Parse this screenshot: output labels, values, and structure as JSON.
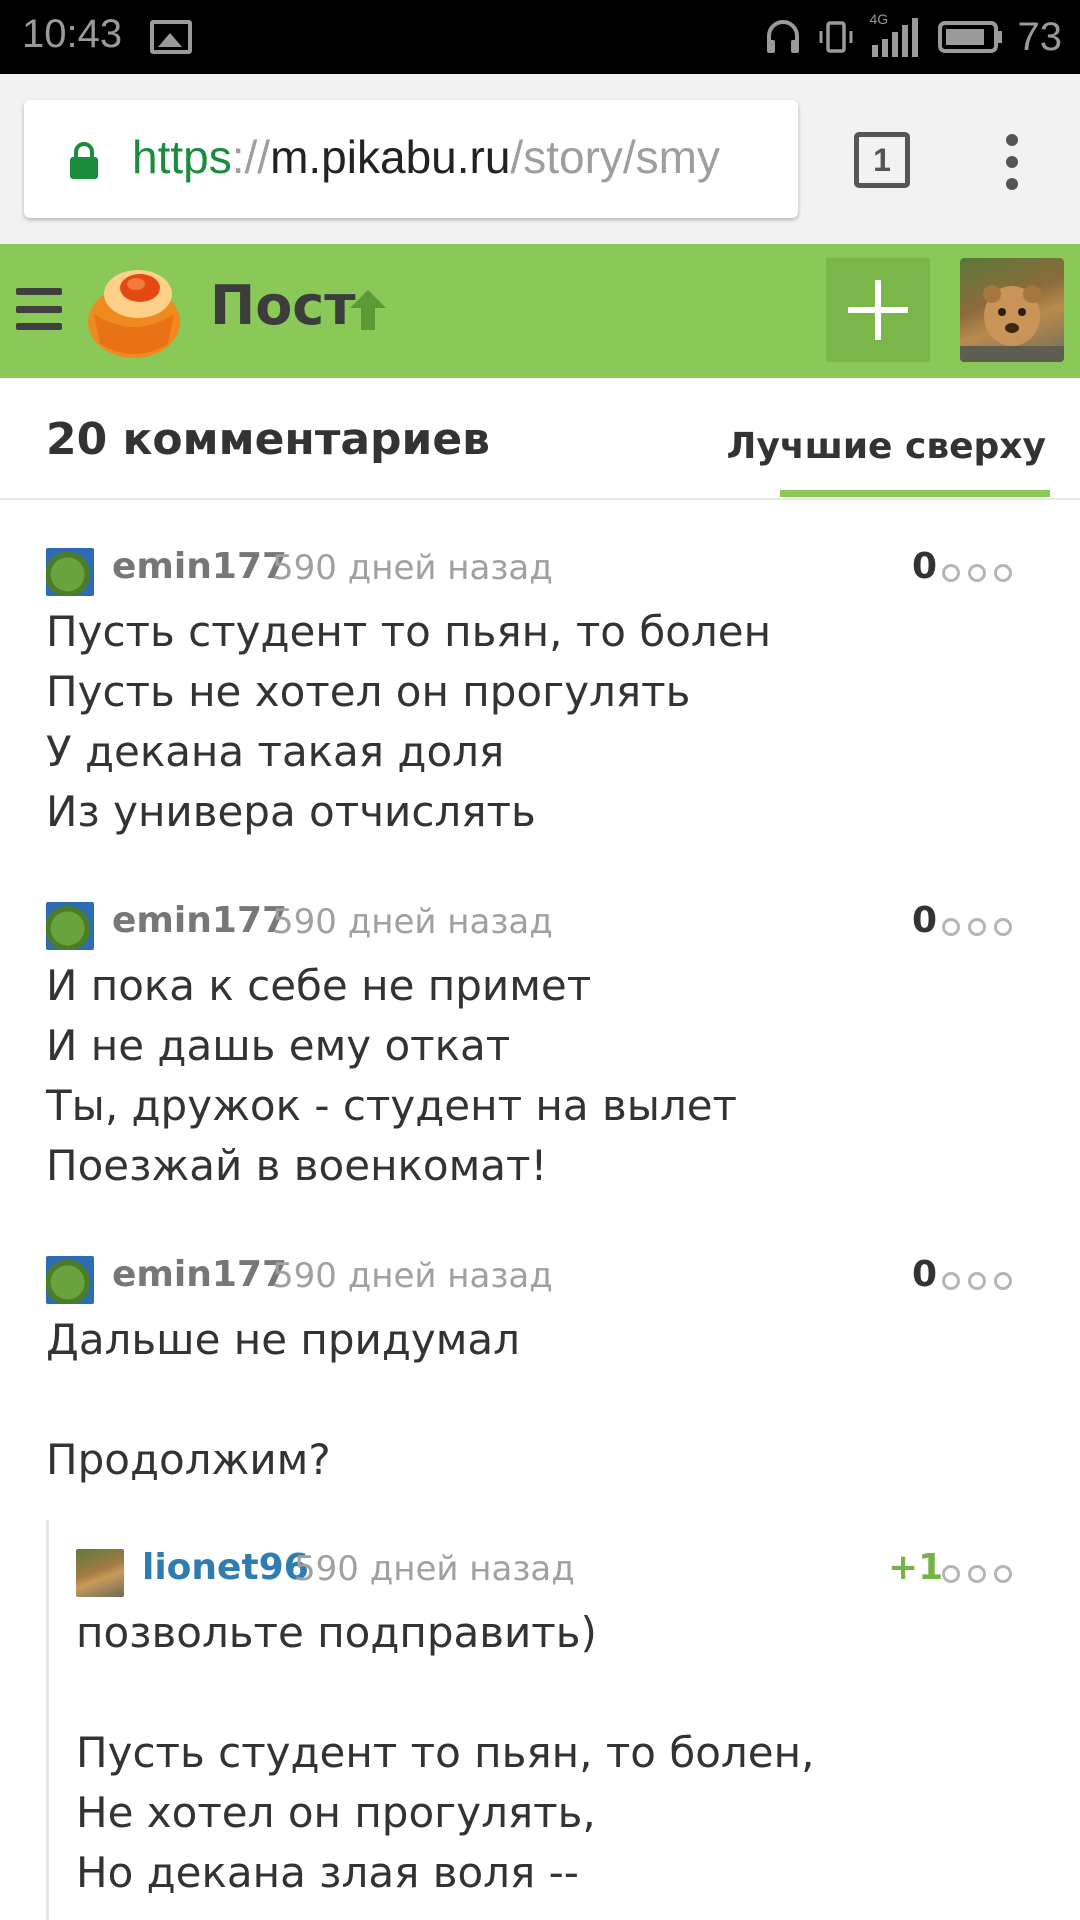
{
  "status_bar": {
    "time": "10:43",
    "network": "4G",
    "battery": "73",
    "icons": [
      "image-icon",
      "headphones-icon",
      "vibrate-icon",
      "signal-icon",
      "battery-icon"
    ]
  },
  "browser": {
    "url_scheme": "https",
    "url_sep": "://",
    "url_host": "m.pikabu.ru",
    "url_path": "/story/smy",
    "tab_count": "1"
  },
  "header": {
    "title": "Пост",
    "accent_color": "#8ac858"
  },
  "comments_header": {
    "count_label": "20 комментариев",
    "sort_label": "Лучшие сверху"
  },
  "comments": [
    {
      "author": "emin177",
      "time": "590 дней назад",
      "rating": "0",
      "text": "Пусть студент то пьян, то болен\nПусть не хотел он прогулять\nУ декана такая доля\nИз универа отчислять"
    },
    {
      "author": "emin177",
      "time": "590 дней назад",
      "rating": "0",
      "text": "И пока к себе не примет\nИ не дашь ему откат\nТы, дружок - студент на вылет\nПоезжай в военкомат!"
    },
    {
      "author": "emin177",
      "time": "590 дней назад",
      "rating": "0",
      "text": "Дальше не придумал\n\nПродолжим?"
    },
    {
      "author": "lionet96",
      "time": "590 дней назад",
      "rating": "+1",
      "text": "позвольте подправить)\n\nПусть студент то пьян, то болен,\nНе хотел он прогулять,\nНо декана злая воля --"
    }
  ]
}
